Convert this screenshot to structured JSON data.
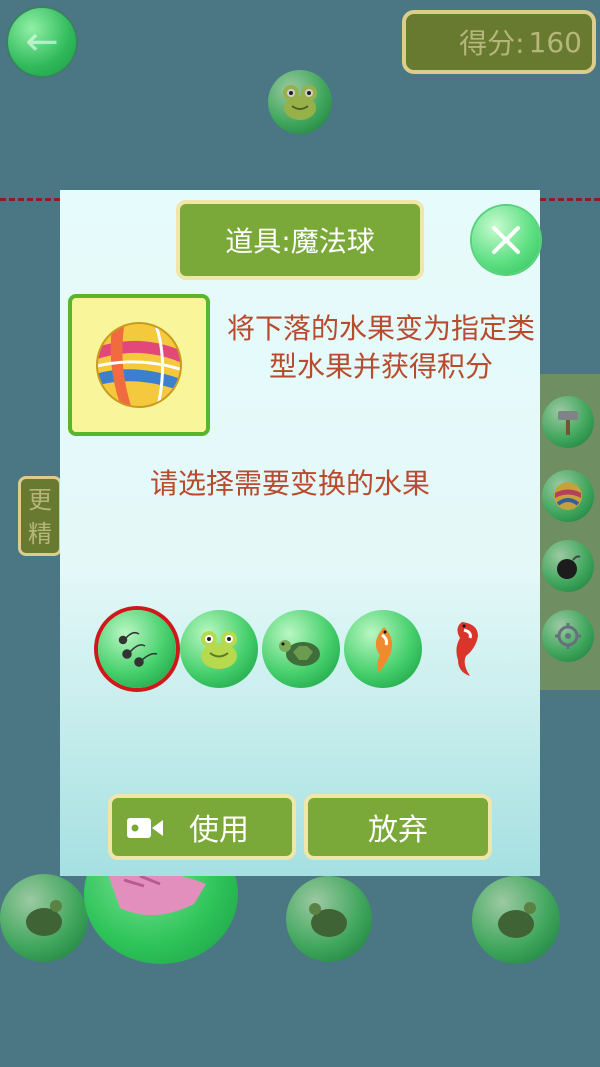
{
  "hud": {
    "back_icon": "arrow-left-icon",
    "score_label": "得分:",
    "score_value": "160"
  },
  "left_tab": {
    "line1": "更",
    "line2": "精"
  },
  "side_tools": [
    {
      "icon": "hammer-icon"
    },
    {
      "icon": "magic-ball-icon"
    },
    {
      "icon": "bomb-icon"
    },
    {
      "icon": "gear-icon"
    }
  ],
  "modal": {
    "title": "道具:魔法球",
    "item_icon": "volleyball-icon",
    "description": "将下落的水果变为指定类型水果并获得积分",
    "instruction": "请选择需要变换的水果",
    "choices": [
      {
        "icon": "tadpole-icon",
        "selected": true
      },
      {
        "icon": "frog-icon",
        "selected": false
      },
      {
        "icon": "turtle-icon",
        "selected": false
      },
      {
        "icon": "koi-fish-icon",
        "selected": false
      },
      {
        "icon": "red-koi-icon",
        "selected": false
      }
    ],
    "use_label": "使用",
    "use_icon": "video-camera-icon",
    "giveup_label": "放弃",
    "close_icon": "close-icon"
  },
  "colors": {
    "background": "#4b7683",
    "button_green": "#7aa93a",
    "button_border": "#efe6a8",
    "text_red": "#b84a2e",
    "selected_ring": "#cc1a1a"
  }
}
